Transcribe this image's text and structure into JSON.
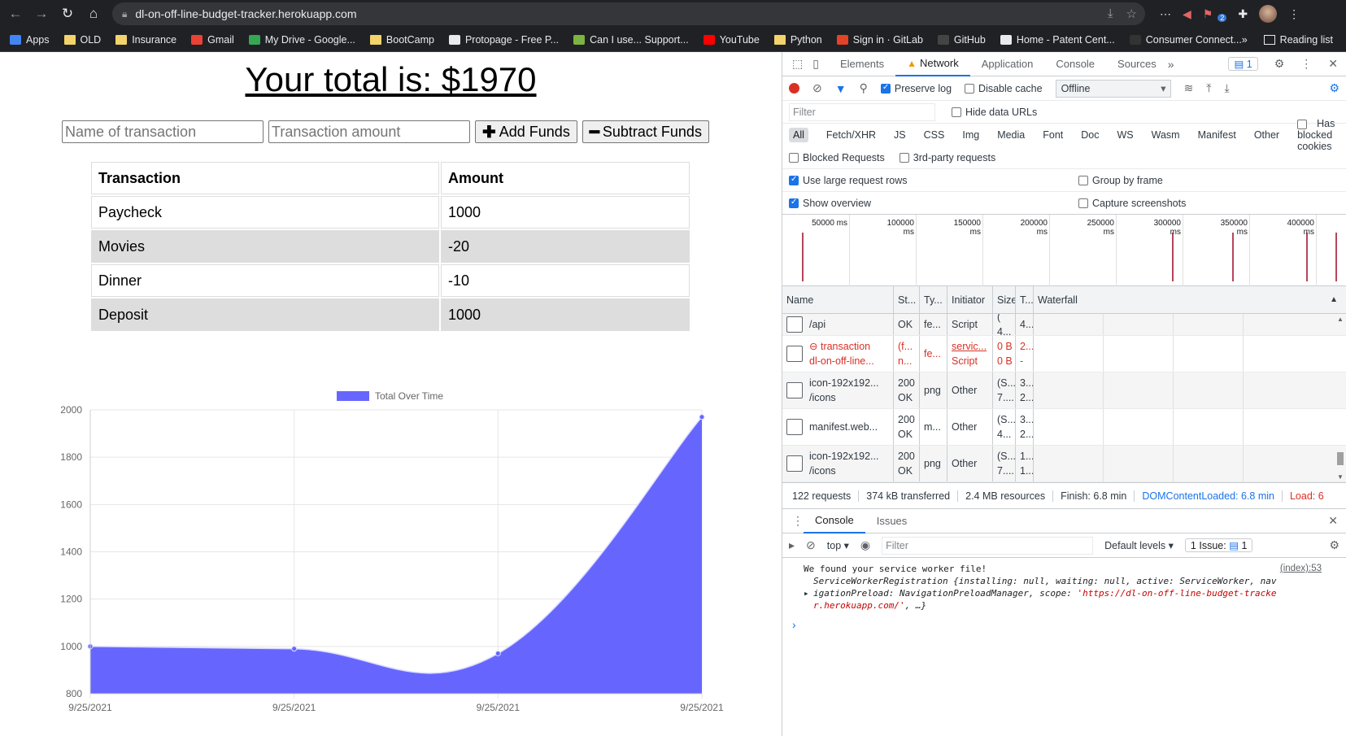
{
  "browser": {
    "url": "dl-on-off-line-budget-tracker.herokuapp.com",
    "bookmarks": [
      {
        "label": "Apps",
        "icon": "apps-grid-icon"
      },
      {
        "label": "OLD",
        "icon": "folder-icon"
      },
      {
        "label": "Insurance",
        "icon": "folder-icon"
      },
      {
        "label": "Gmail",
        "icon": "gmail-icon"
      },
      {
        "label": "My Drive - Google...",
        "icon": "drive-icon"
      },
      {
        "label": "BootCamp",
        "icon": "folder-icon"
      },
      {
        "label": "Protopage - Free P...",
        "icon": "protopage-icon"
      },
      {
        "label": "Can I use... Support...",
        "icon": "caniuse-icon"
      },
      {
        "label": "YouTube",
        "icon": "youtube-icon"
      },
      {
        "label": "Python",
        "icon": "folder-icon"
      },
      {
        "label": "Sign in · GitLab",
        "icon": "gitlab-icon"
      },
      {
        "label": "GitHub",
        "icon": "github-icon"
      },
      {
        "label": "Home - Patent Cent...",
        "icon": "patent-icon"
      },
      {
        "label": "Consumer Connect...",
        "icon": "consumer-icon"
      }
    ],
    "more": "»",
    "reading_list": "Reading list",
    "ext_badge": "2"
  },
  "app": {
    "total_label": "Your total is: $1970",
    "name_placeholder": "Name of transaction",
    "amount_placeholder": "Transaction amount",
    "add_label": "Add Funds",
    "subtract_label": "Subtract Funds",
    "table": {
      "headers": [
        "Transaction",
        "Amount"
      ],
      "rows": [
        {
          "name": "Paycheck",
          "amount": "1000"
        },
        {
          "name": "Movies",
          "amount": "-20"
        },
        {
          "name": "Dinner",
          "amount": "-10"
        },
        {
          "name": "Deposit",
          "amount": "1000"
        }
      ]
    }
  },
  "chart_data": {
    "type": "area",
    "x": [
      "9/25/2021",
      "9/25/2021",
      "9/25/2021",
      "9/25/2021"
    ],
    "series": [
      {
        "name": "Total Over Time",
        "values": [
          1000,
          990,
          970,
          1970
        ],
        "color": "#6666ff"
      }
    ],
    "ylim": [
      800,
      2000
    ],
    "yticks": [
      800,
      1000,
      1200,
      1400,
      1600,
      1800,
      2000
    ],
    "legend": "top",
    "grid": true
  },
  "devtools": {
    "tabs": [
      "Elements",
      "Network",
      "Application",
      "Console",
      "Sources"
    ],
    "more_tabs": "»",
    "msg_count": "1",
    "preserve_log": "Preserve log",
    "disable_cache": "Disable cache",
    "throttle": "Offline",
    "filter_placeholder": "Filter",
    "hide_data_urls": "Hide data URLs",
    "types": [
      "All",
      "Fetch/XHR",
      "JS",
      "CSS",
      "Img",
      "Media",
      "Font",
      "Doc",
      "WS",
      "Wasm",
      "Manifest",
      "Other"
    ],
    "has_blocked_cookies": "Has blocked cookies",
    "blocked_requests": "Blocked Requests",
    "third_party": "3rd-party requests",
    "large_rows": "Use large request rows",
    "group_by_frame": "Group by frame",
    "show_overview": "Show overview",
    "capture_screenshots": "Capture screenshots",
    "timeline_ticks": [
      "50000 ms",
      "100000 ms",
      "150000 ms",
      "200000 ms",
      "250000 ms",
      "300000 ms",
      "350000 ms",
      "400000 ms"
    ],
    "columns": [
      "Name",
      "St...",
      "Ty...",
      "Initiator",
      "Size",
      "T...",
      "Waterfall"
    ],
    "requests": [
      {
        "name1": "",
        "name2": "/api",
        "st1": "",
        "st2": "OK",
        "type": "fe...",
        "init1": "",
        "init2": "Script",
        "size1": "(",
        "size2": "4...",
        "t1": "",
        "t2": "4...",
        "err": false,
        "partial": true
      },
      {
        "name1": "transaction",
        "name2": "dl-on-off-line...",
        "st1": "(f...",
        "st2": "n...",
        "type": "fe...",
        "init1": "servic...",
        "init2": "Script",
        "size1": "0 B",
        "size2": "0 B",
        "t1": "2...",
        "t2": "-",
        "err": true
      },
      {
        "name1": "icon-192x192...",
        "name2": "/icons",
        "st1": "200",
        "st2": "OK",
        "type": "png",
        "init1": "Other",
        "init2": "",
        "size1": "(S...",
        "size2": "7....",
        "t1": "3...",
        "t2": "2...",
        "err": false
      },
      {
        "name1": "manifest.web...",
        "name2": "",
        "st1": "200",
        "st2": "OK",
        "type": "m...",
        "init1": "Other",
        "init2": "",
        "size1": "(S...",
        "size2": "4...",
        "t1": "3...",
        "t2": "2...",
        "err": false
      },
      {
        "name1": "icon-192x192...",
        "name2": "/icons",
        "st1": "200",
        "st2": "OK",
        "type": "png",
        "init1": "Other",
        "init2": "",
        "size1": "(S...",
        "size2": "7....",
        "t1": "1...",
        "t2": "1...",
        "err": false
      }
    ],
    "summary": {
      "requests": "122 requests",
      "transferred": "374 kB transferred",
      "resources": "2.4 MB resources",
      "finish": "Finish: 6.8 min",
      "dcl": "DOMContentLoaded: 6.8 min",
      "load": "Load: 6"
    },
    "drawer_tabs": [
      "Console",
      "Issues"
    ],
    "context": "top",
    "console_filter": "Filter",
    "levels": "Default levels",
    "issues": "1 Issue:",
    "issues_count": "1",
    "log": {
      "line1": "We found your service worker file!",
      "source": "(index):53",
      "line2": "ServiceWorkerRegistration {installing: null, waiting: null, active: ServiceWorker, nav",
      "line3": "igationPreload: NavigationPreloadManager, scope: ",
      "scope": "'https://dl-on-off-line-budget-tracke",
      "line4a": "r.herokuapp.com/'",
      "line4b": ", …}"
    }
  }
}
